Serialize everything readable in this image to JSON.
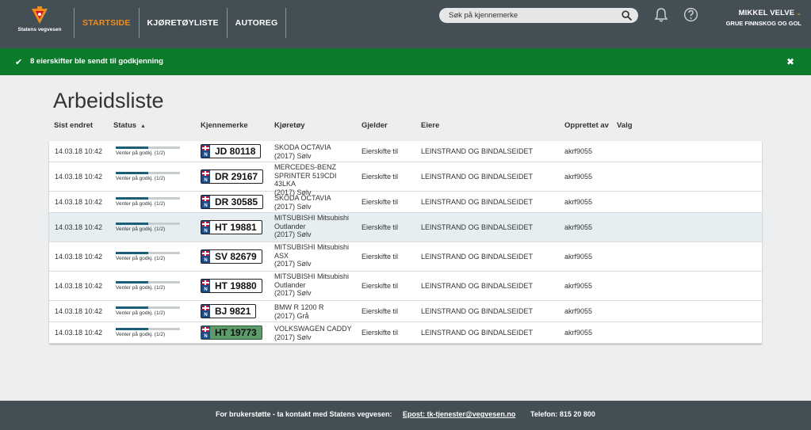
{
  "brand": {
    "logo_text": "Statens vegvesen"
  },
  "nav": [
    {
      "label": "STARTSIDE",
      "active": true
    },
    {
      "label": "KJØRETØYLISTE",
      "active": false
    },
    {
      "label": "AUTOREG",
      "active": false
    }
  ],
  "search": {
    "placeholder": "Søk på kjennemerke"
  },
  "user": {
    "name": "MIKKEL VELVE",
    "org": "GRUE FINNSKOG OG GOL"
  },
  "notice": {
    "text": "8 eierskifter ble sendt til godkjenning",
    "color": "#0b7a2b"
  },
  "page": {
    "title": "Arbeidsliste"
  },
  "columns": {
    "sist_endret": "Sist endret",
    "status": "Status",
    "kjennemerke": "Kjennemerke",
    "kjoretoy": "Kjøretøy",
    "gjelder": "Gjelder",
    "eiere": "Eiere",
    "opprettet_av": "Opprettet av",
    "valg": "Valg"
  },
  "rows": [
    {
      "date": "14.03.18 10:42",
      "status": "Venter på godkj. (1/2)",
      "progress": 0.5,
      "plate": "JD 80118",
      "plate_color": "white",
      "vehicle_line1": "SKODA OCTAVIA",
      "vehicle_line2": "(2017) Sølv",
      "gjelder": "Eierskifte til",
      "eiere": "LEINSTRAND OG BINDALSEIDET",
      "opprettet_av": "akrf9055",
      "highlight": false
    },
    {
      "date": "14.03.18 10:42",
      "status": "Venter på godkj. (1/2)",
      "progress": 0.5,
      "plate": "DR 29167",
      "plate_color": "white",
      "vehicle_line1": "MERCEDES-BENZ SPRINTER 519CDI 43LKA",
      "vehicle_line2": "(2017) Sølv",
      "gjelder": "Eierskifte til",
      "eiere": "LEINSTRAND OG BINDALSEIDET",
      "opprettet_av": "akrf9055",
      "highlight": false
    },
    {
      "date": "14.03.18 10:42",
      "status": "Venter på godkj. (1/2)",
      "progress": 0.5,
      "plate": "DR 30585",
      "plate_color": "white",
      "vehicle_line1": "SKODA OCTAVIA",
      "vehicle_line2": "(2017) Sølv",
      "gjelder": "Eierskifte til",
      "eiere": "LEINSTRAND OG BINDALSEIDET",
      "opprettet_av": "akrf9055",
      "highlight": false
    },
    {
      "date": "14.03.18 10:42",
      "status": "Venter på godkj. (1/2)",
      "progress": 0.5,
      "plate": "HT 19881",
      "plate_color": "white",
      "vehicle_line1": "MITSUBISHI Mitsubishi Outlander",
      "vehicle_line2": "(2017) Sølv",
      "gjelder": "Eierskifte til",
      "eiere": "LEINSTRAND OG BINDALSEIDET",
      "opprettet_av": "akrf9055",
      "highlight": true
    },
    {
      "date": "14.03.18 10:42",
      "status": "Venter på godkj. (1/2)",
      "progress": 0.5,
      "plate": "SV 82679",
      "plate_color": "white",
      "vehicle_line1": "MITSUBISHI Mitsubishi ASX",
      "vehicle_line2": "(2017) Sølv",
      "gjelder": "Eierskifte til",
      "eiere": "LEINSTRAND OG BINDALSEIDET",
      "opprettet_av": "akrf9055",
      "highlight": false
    },
    {
      "date": "14.03.18 10:42",
      "status": "Venter på godkj. (1/2)",
      "progress": 0.5,
      "plate": "HT 19880",
      "plate_color": "white",
      "vehicle_line1": "MITSUBISHI Mitsubishi Outlander",
      "vehicle_line2": "(2017) Sølv",
      "gjelder": "Eierskifte til",
      "eiere": "LEINSTRAND OG BINDALSEIDET",
      "opprettet_av": "akrf9055",
      "highlight": false
    },
    {
      "date": "14.03.18 10:42",
      "status": "Venter på godkj. (1/2)",
      "progress": 0.5,
      "plate": "BJ 9821",
      "plate_color": "white",
      "vehicle_line1": "BMW R 1200 R",
      "vehicle_line2": "(2017) Grå",
      "gjelder": "Eierskifte til",
      "eiere": "LEINSTRAND OG BINDALSEIDET",
      "opprettet_av": "akrf9055",
      "highlight": false
    },
    {
      "date": "14.03.18 10:42",
      "status": "Venter på godkj. (1/2)",
      "progress": 0.5,
      "plate": "HT 19773",
      "plate_color": "green",
      "vehicle_line1": "VOLKSWAGEN CADDY",
      "vehicle_line2": "(2017) Sølv",
      "gjelder": "Eierskifte til",
      "eiere": "LEINSTRAND OG BINDALSEIDET",
      "opprettet_av": "akrf9055",
      "highlight": false
    }
  ],
  "footer": {
    "support": "For brukerstøtte - ta kontakt med Statens vegvesen:",
    "email": "Epost: tk-tjenester@vegvesen.no",
    "phone": "Telefon: 815 20 800"
  },
  "colors": {
    "accent": "#f28c1b",
    "topbar": "#444f55",
    "success": "#0b7a2b"
  },
  "icons": [
    "statens-vegvesen-logo",
    "search-icon",
    "bell-icon",
    "help-icon",
    "chevron-down-icon",
    "checkmark-icon",
    "close-icon",
    "sort-up-icon",
    "norway-flag-icon"
  ]
}
